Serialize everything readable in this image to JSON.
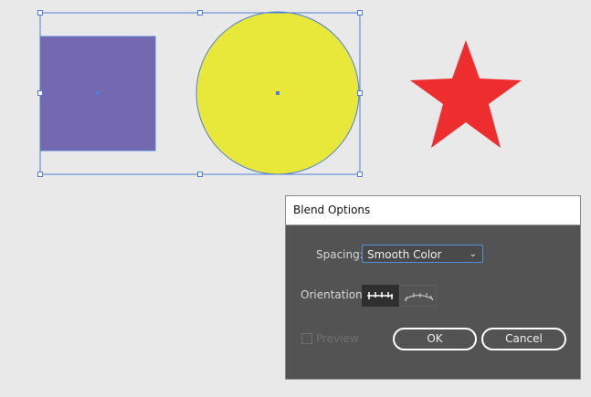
{
  "dialog": {
    "title": "Blend Options",
    "spacing_label": "Spacing:",
    "spacing_value": "Smooth Color",
    "orientation_label": "Orientation:",
    "preview_label": "Preview",
    "ok_label": "OK",
    "cancel_label": "Cancel"
  },
  "colors": {
    "square": "#7468b0",
    "circle": "#e8e83a",
    "star": "#ee2e2e",
    "selection": "#4f7fd8"
  }
}
